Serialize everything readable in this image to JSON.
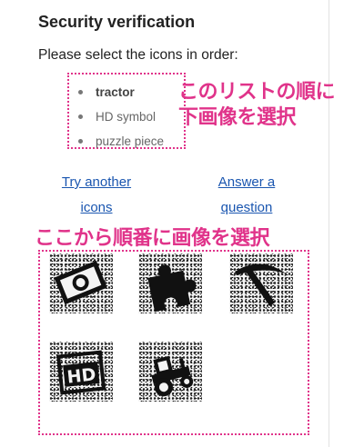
{
  "captcha": {
    "title": "Security verification",
    "instruction": "Please select the icons in order:",
    "items": [
      {
        "label": "tractor",
        "state": "selected"
      },
      {
        "label": "HD symbol",
        "state": "pending"
      },
      {
        "label": "puzzle piece",
        "state": "pending"
      }
    ],
    "links": {
      "try_another_line1": "Try another",
      "try_another_line2": "icons",
      "answer_line1": "Answer a",
      "answer_line2": "question"
    },
    "tiles": [
      "money-icon",
      "puzzle-piece-icon",
      "pickaxe-icon",
      "hd-symbol-icon",
      "tractor-icon"
    ]
  },
  "annotations": {
    "list_note_line1": "このリストの順に",
    "list_note_line2": "下画像を選択",
    "grid_note": "ここから順番に画像を選択",
    "accent_color": "#e0338a"
  },
  "colors": {
    "link": "#1a56b0",
    "text": "#222222"
  }
}
